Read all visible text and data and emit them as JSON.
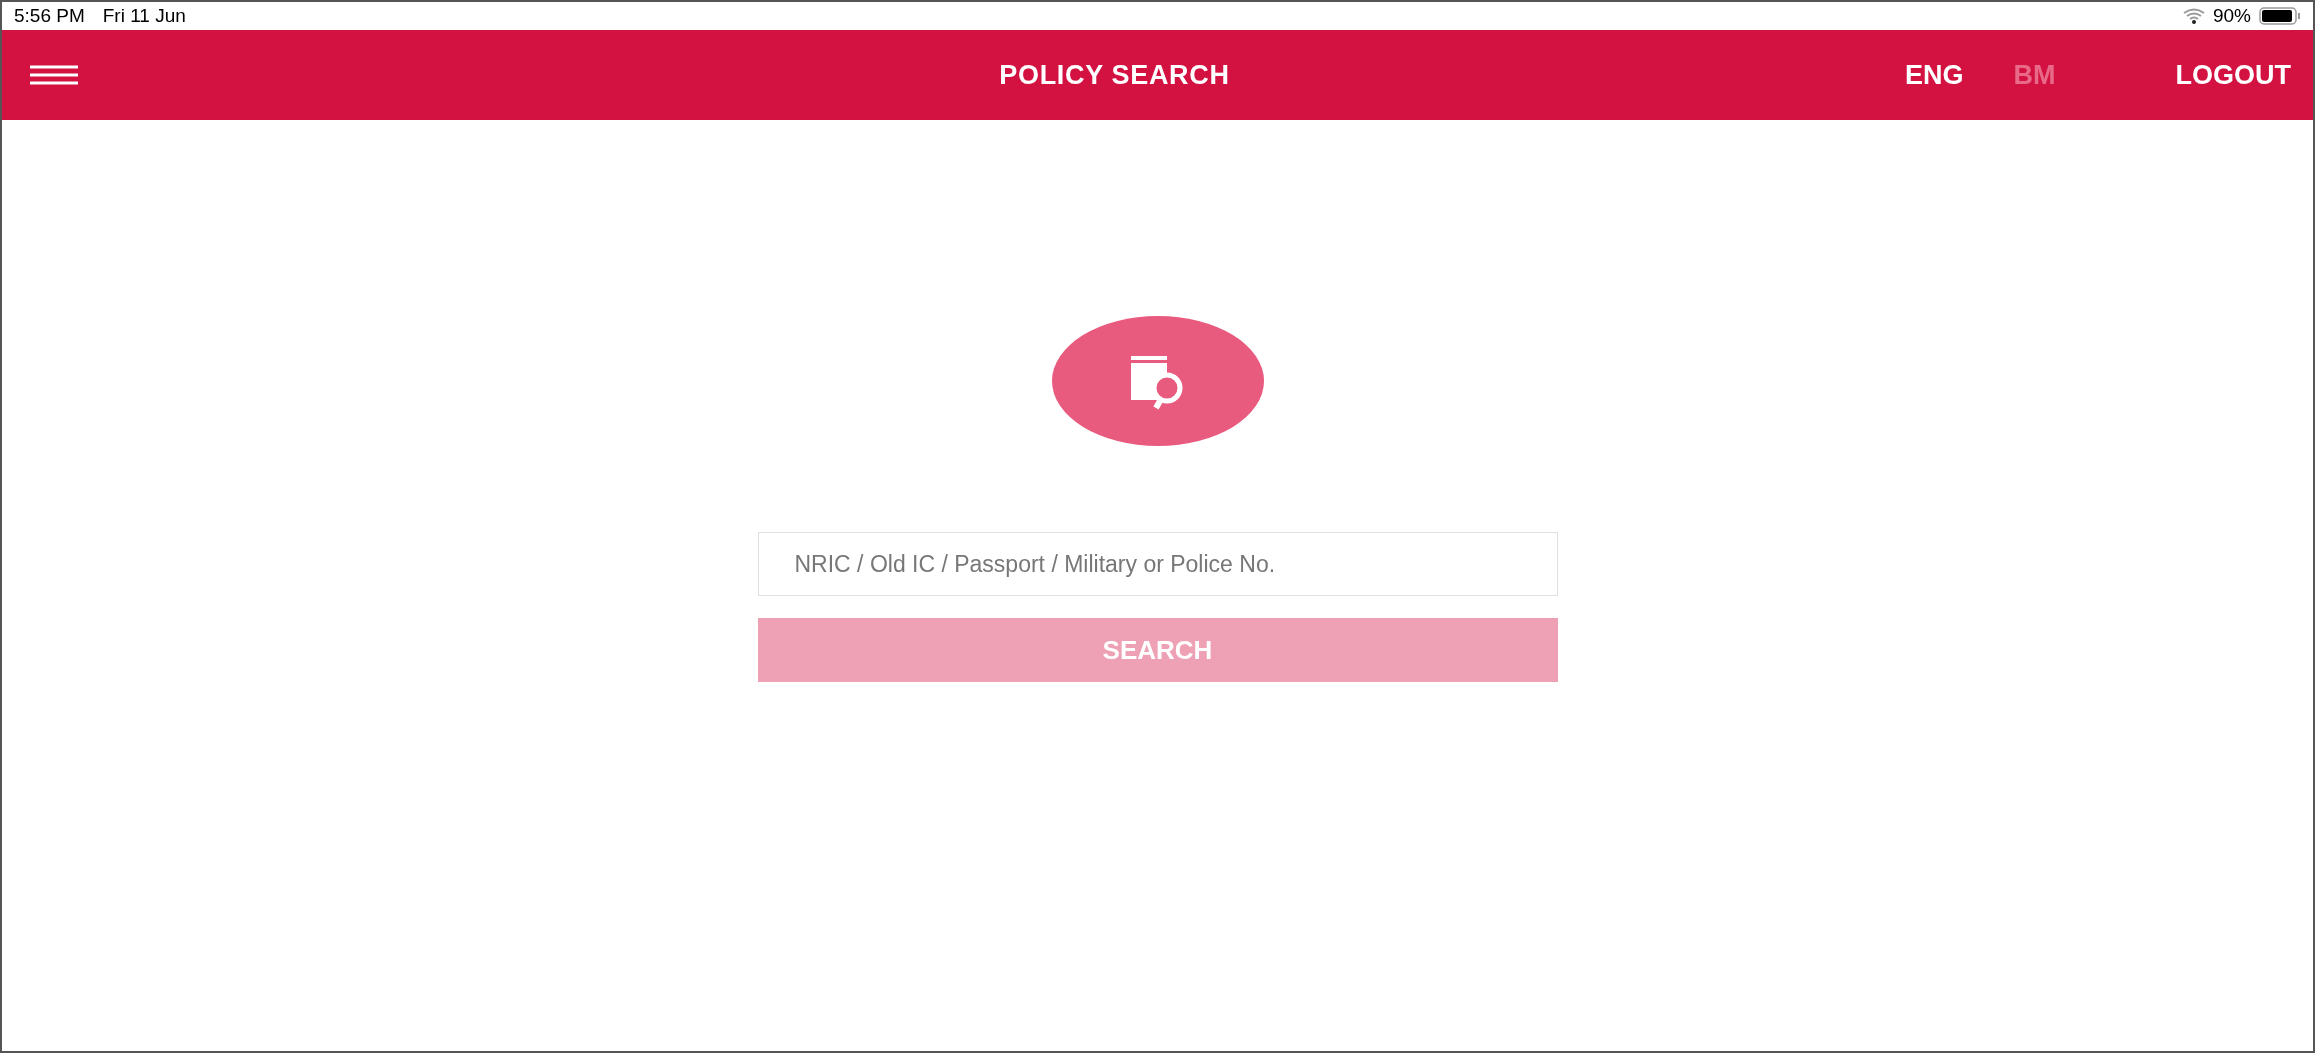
{
  "status_bar": {
    "time": "5:56 PM",
    "date": "Fri 11 Jun",
    "battery": "90%"
  },
  "header": {
    "title": "POLICY SEARCH",
    "languages": [
      {
        "label": "ENG",
        "selected": true
      },
      {
        "label": "BM",
        "selected": false
      }
    ],
    "logout": "LOGOUT"
  },
  "search": {
    "placeholder": "NRIC / Old IC / Passport / Military or Police No.",
    "button": {
      "label": "SEARCH",
      "disabled": true
    }
  }
}
